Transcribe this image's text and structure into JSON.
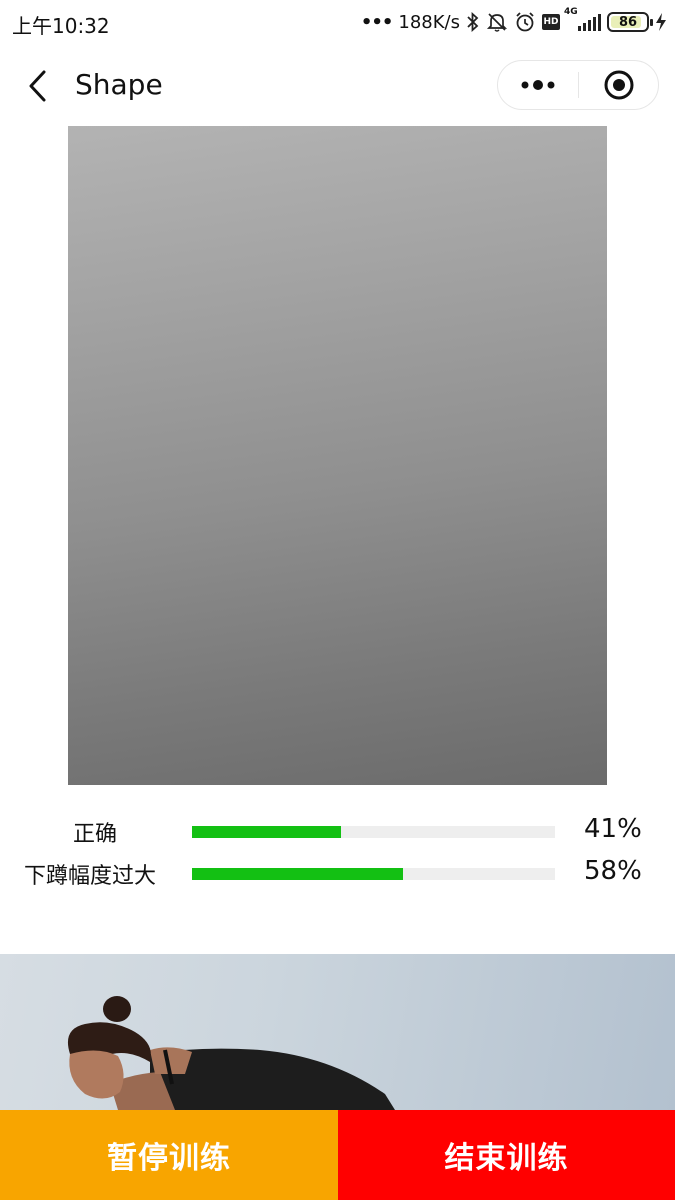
{
  "status_bar": {
    "time": "上午10:32",
    "network_speed": "188K/s",
    "network_type": "4G",
    "hd_badge": "HD",
    "battery": "86"
  },
  "nav": {
    "title": "Shape"
  },
  "stats": [
    {
      "label": "正确",
      "value_text": "41%",
      "fraction": 0.41
    },
    {
      "label": "下蹲幅度过大",
      "value_text": "58%",
      "fraction": 0.58
    }
  ],
  "buttons": {
    "pause": "暂停训练",
    "end": "结束训练"
  },
  "colors": {
    "progress": "#13c013",
    "pause": "#f8a500",
    "end": "#ff0000"
  }
}
